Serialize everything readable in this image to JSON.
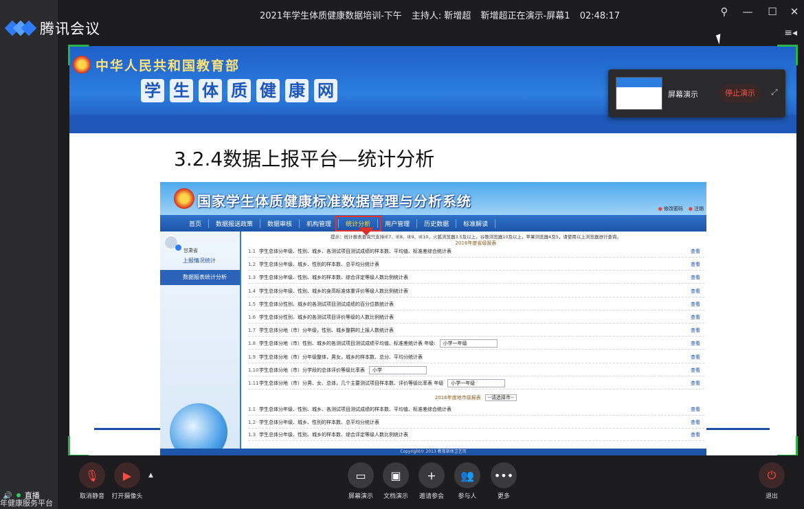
{
  "app": {
    "name": "腾讯会议"
  },
  "titlebar": {
    "meeting_title": "2021年学生体质健康数据培训-下午",
    "host": "主持人: 靳增超",
    "status": "靳增超正在演示-屏幕1",
    "timer": "02:48:17",
    "pin_icon": "pin-icon",
    "minimize": "—",
    "maximize": "☐",
    "close": "✕",
    "panel_toggle": "≡◂"
  },
  "slide": {
    "ministry": "中华人民共和国教育部",
    "site_name": [
      "学",
      "生",
      "体",
      "质",
      "健",
      "康",
      "网"
    ],
    "title": "3.2.4数据上报平台—统计分析"
  },
  "inner": {
    "system_title": "国家学生体质健康标准数据管理与分析系统",
    "links": [
      "修改密码",
      "注销"
    ],
    "nav": [
      "首页",
      "数据报送政策",
      "数据审核",
      "机构管理",
      "统计分析",
      "用户管理",
      "历史数据",
      "标准解读"
    ],
    "active_nav": 4,
    "side_user": "甘肃省",
    "side_items": [
      "上报情况统计",
      "数据报表统计分析"
    ],
    "tip": "提示：统计报表查询只支持IE7、IE8、IE9、IE10，火狐浏览器3.5及以上，谷歌浏览器10及以上，苹果浏览器4及5，请使用以上浏览器进行查询。",
    "report_head_1": "2016年度省级报表",
    "report_head_2": "2016年度地市级报表",
    "city_select": "--请选择市--",
    "view_label": "查看",
    "rows": [
      {
        "num": "1.1",
        "text": "学生总体分年级、性别、城乡、各测试项目测试成绩的样本数、平均值、标准差综合统计表"
      },
      {
        "num": "1.2",
        "text": "学生总体分年级、城乡、性别的样本数、总平均分统计表"
      },
      {
        "num": "1.3",
        "text": "学生总体分年级、性别、城乡的样本数、综合评定等级人数比例统计表"
      },
      {
        "num": "1.4",
        "text": "学生总体分年级、性别、城乡的身高标准体重评价等级人数比例统计表"
      },
      {
        "num": "1.5",
        "text": "学生总体分性别、城乡的各测试项目测试成绩的百分位数统计表"
      },
      {
        "num": "1.6",
        "text": "学生总体分性别、城乡的各测试项目评价等级的人数比例统计表"
      },
      {
        "num": "1.7",
        "text": "学生总体分地（市）分年级，性别、城乡整群的上报人数统计表"
      },
      {
        "num": "1.8",
        "text": "学生总体分地（市）性别、城乡的各测试项目测试成绩平均值、标准差统计表  年级:",
        "select": "小学一年级"
      },
      {
        "num": "1.9",
        "text": "学生总体分地（市）分年级整体，男女，城乡的样本数、总分、平均分统计表"
      },
      {
        "num": "1.10",
        "text": "学生总体分地（市）分学段的总体评价等级比率表",
        "select": "小学"
      },
      {
        "num": "1.11",
        "text": "学生总体分地（市）分男、女、总体，几个主要测试项目样本数、评价等级比率表  年级",
        "select": "小学一年级"
      }
    ],
    "city_rows": [
      {
        "num": "1.1",
        "text": "学生总体分年级、性别、城乡、各测试项目测试成绩的样本数、平均值、标准差综合统计表"
      },
      {
        "num": "1.2",
        "text": "学生总体分年级、城乡、性别的样本数、总平均分统计表"
      },
      {
        "num": "1.3",
        "text": "学生总体分年级、性别、城乡的样本数、综合评定等级人数比例统计表"
      }
    ],
    "footer": "Copyright© 2013 教育部体卫艺司"
  },
  "share_popup": {
    "label": "屏幕演示",
    "stop": "停止演示",
    "expand_icon": "expand-icon"
  },
  "toolbar": {
    "mute": "取消静音",
    "camera": "打开摄像头",
    "screen_share": "屏幕演示",
    "doc_share": "文档演示",
    "invite": "邀请参会",
    "participants": "参与人",
    "more": "更多",
    "leave": "退出"
  },
  "status": {
    "live": "直播",
    "caption": "年健康服务平台"
  },
  "colors": {
    "accent": "#2f7bf6",
    "danger": "#f0534a",
    "share_frame": "#29b34a"
  }
}
